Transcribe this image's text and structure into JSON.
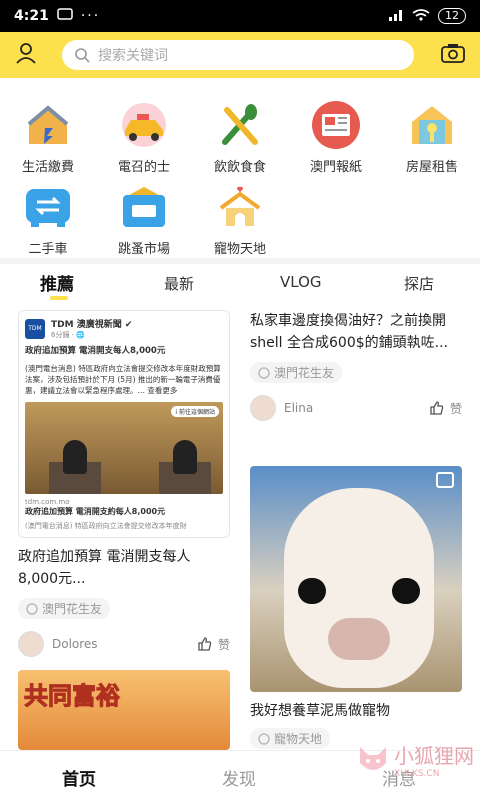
{
  "status_bar": {
    "time": "4:21",
    "dots": "···",
    "battery": "12"
  },
  "header": {
    "search_placeholder": "搜索关键词"
  },
  "categories": [
    {
      "label": "生活繳費",
      "icon": "house-bill-icon"
    },
    {
      "label": "電召的士",
      "icon": "taxi-icon"
    },
    {
      "label": "飲飲食食",
      "icon": "utensils-icon"
    },
    {
      "label": "澳門報紙",
      "icon": "newspaper-icon"
    },
    {
      "label": "房屋租售",
      "icon": "house-key-icon"
    },
    {
      "label": "二手車",
      "icon": "car-swap-icon"
    },
    {
      "label": "跳蚤市場",
      "icon": "secondhand-icon"
    },
    {
      "label": "寵物天地",
      "icon": "pet-house-icon"
    }
  ],
  "tabs": [
    {
      "label": "推薦",
      "active": true
    },
    {
      "label": "最新",
      "active": false
    },
    {
      "label": "VLOG",
      "active": false
    },
    {
      "label": "探店",
      "active": false
    }
  ],
  "feed": {
    "left": [
      {
        "news": {
          "logo": "TDM",
          "source": "TDM 澳廣視新聞 ✔",
          "meta": "6分鐘 · 🌐",
          "headline": "政府追加預算 電消開支每人8,000元",
          "body": "(澳門電台消息) 特區政府向立法會提交修改本年度財政預算法案，涉及包括預計於下月 (5月) 推出的新一輪電子消費優惠，建議立法會以緊急程序處理。… 查看更多",
          "photo_badge": "i 前往這個網站",
          "link_domain": "tdm.com.mo",
          "link_title": "政府追加預算 電消開支約每人8,000元",
          "link_desc": "(澳門電台消息) 特區政府向立法會提交修改本年度財"
        },
        "title": "政府追加預算 電消開支每人8,000元...",
        "tag": "澳門花生友",
        "user": "Dolores",
        "like_label": "赞"
      },
      {
        "banner_text": "共同富裕"
      }
    ],
    "right": [
      {
        "title": "私家車邊度換偈油好？之前換開shell 全合成600$的鋪頭執咗...",
        "tag": "澳門花生友",
        "user": "Elina",
        "like_label": "赞"
      },
      {
        "title": "我好想養草泥馬做寵物",
        "tag": "寵物天地"
      }
    ]
  },
  "bottom_nav": [
    {
      "label": "首页",
      "active": true
    },
    {
      "label": "发现",
      "active": false
    },
    {
      "label": "消息",
      "active": false
    }
  ],
  "watermark": {
    "text": "小狐狸网",
    "sub": "XHLKS.CN"
  },
  "colors": {
    "accent": "#fce04d",
    "tag_bg": "#f4f4f4"
  }
}
